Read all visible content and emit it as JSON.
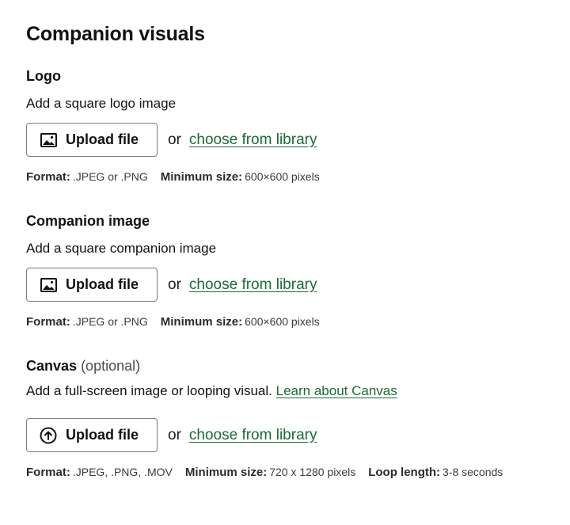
{
  "page": {
    "title": "Companion visuals"
  },
  "sections": [
    {
      "title": "Logo",
      "optional": "",
      "description": "Add a square logo image",
      "link": "",
      "upload_label": "Upload file",
      "upload_icon": "image-icon",
      "or_text": "or",
      "choose_label": "choose from library",
      "meta": [
        {
          "label": "Format:",
          "value": ".JPEG or .PNG"
        },
        {
          "label": "Minimum size:",
          "value": "600×600 pixels"
        }
      ]
    },
    {
      "title": "Companion image",
      "optional": "",
      "description": "Add a square companion image",
      "link": "",
      "upload_label": "Upload file",
      "upload_icon": "image-icon",
      "or_text": "or",
      "choose_label": "choose from library",
      "meta": [
        {
          "label": "Format:",
          "value": ".JPEG or .PNG"
        },
        {
          "label": "Minimum size:",
          "value": "600×600 pixels"
        }
      ]
    },
    {
      "title": "Canvas",
      "optional": "(optional)",
      "description": "Add a full-screen image or looping visual.",
      "link": "Learn about Canvas",
      "upload_label": "Upload file",
      "upload_icon": "upload-arrow-icon",
      "or_text": "or",
      "choose_label": "choose from library",
      "meta": [
        {
          "label": "Format:",
          "value": ".JPEG, .PNG, .MOV"
        },
        {
          "label": "Minimum size:",
          "value": "720 x 1280 pixels"
        },
        {
          "label": "Loop length:",
          "value": "3-8 seconds"
        }
      ]
    }
  ],
  "colors": {
    "link": "#1a6b34",
    "text": "#121212",
    "border": "#7d7d7d"
  }
}
